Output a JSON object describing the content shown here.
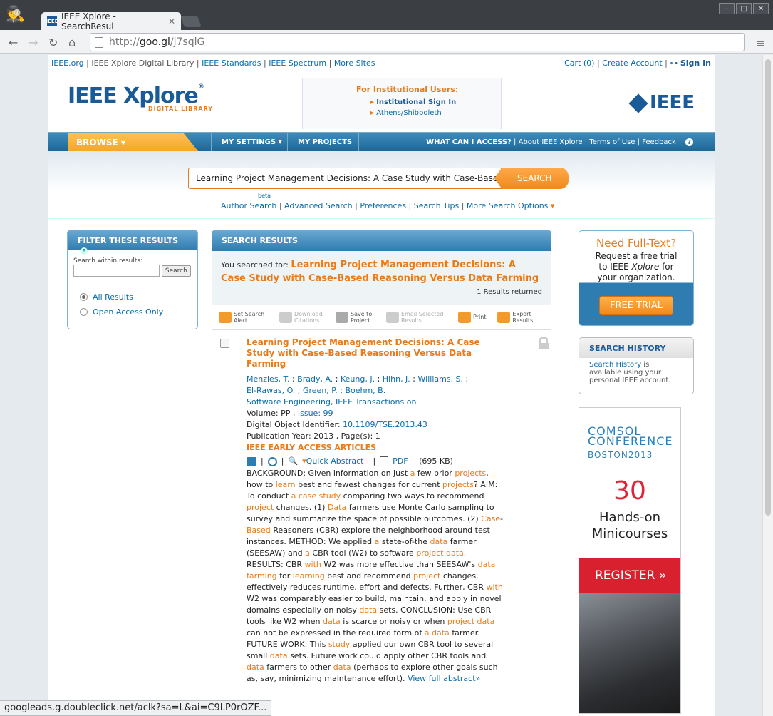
{
  "browser": {
    "tab_title": "IEEE Xplore - SearchResul",
    "url_host": "goo.gl",
    "url_prefix": "http://",
    "url_path": "/j7sqlG",
    "status_url": "googleads.g.doubleclick.net/aclk?sa=L&ai=C9LP0rOZF..."
  },
  "utility": {
    "left": [
      "IEEE.org",
      "IEEE Xplore Digital Library",
      "IEEE Standards",
      "IEEE Spectrum",
      "More Sites"
    ],
    "cart": "Cart (0)",
    "create": "Create Account",
    "signin": "Sign In"
  },
  "header": {
    "logo_main": "IEEE Xplore",
    "logo_sub": "DIGITAL LIBRARY",
    "inst_title": "For Institutional Users:",
    "inst_signin": "Institutional Sign In",
    "inst_athens": "Athens/Shibboleth",
    "ieee": "IEEE"
  },
  "nav": {
    "browse": "BROWSE",
    "settings": "MY SETTINGS",
    "projects": "MY PROJECTS",
    "access": "WHAT CAN I ACCESS?",
    "about": "About IEEE Xplore",
    "terms": "Terms of Use",
    "feedback": "Feedback",
    "help": "?"
  },
  "search": {
    "value": "Learning Project Management Decisions: A Case Study with Case-Based I",
    "button": "SEARCH",
    "author": "Author Search",
    "beta": "beta",
    "advanced": "Advanced Search",
    "prefs": "Preferences",
    "tips": "Search Tips",
    "more": "More Search Options"
  },
  "filter": {
    "title": "FILTER THESE RESULTS",
    "within": "Search within results:",
    "search_btn": "Search",
    "all": "All Results",
    "open": "Open Access Only"
  },
  "results": {
    "title": "SEARCH RESULTS",
    "searched_label": "You searched for:",
    "query": "Learning Project Management Decisions: A Case Study with Case-Based Reasoning Versus Data Farming",
    "count": "1 Results returned",
    "tools": [
      "Set Search Alert",
      "Download Citations",
      "Save to Project",
      "Email Selected Results",
      "Print",
      "Export Results"
    ]
  },
  "item": {
    "title": "Learning Project Management Decisions: A Case Study with Case-Based Reasoning Versus Data Farming",
    "authors_line1": [
      "Menzies, T.",
      "Brady, A.",
      "Keung, J.",
      "Hihn, J.",
      "Williams, S."
    ],
    "authors_line2": [
      "El-Rawas, O.",
      "Green, P.",
      "Boehm, B."
    ],
    "journal": "Software Engineering, IEEE Transactions on",
    "volume_label": "Volume: PP , ",
    "issue": "Issue: 99",
    "doi_label": "Digital Object Identifier: ",
    "doi": "10.1109/TSE.2013.43",
    "year": "Publication Year: 2013 , Page(s): 1",
    "early": "IEEE EARLY ACCESS ARTICLES",
    "quick": "Quick Abstract",
    "pdf": "PDF",
    "size": "(695 KB)",
    "view_full": "View full abstract»"
  },
  "sidebar": {
    "need": "Need Full-Text?",
    "req1": "Request a free trial",
    "req2": "to IEEE",
    "req_italic": "Xplore",
    "req3": "for",
    "req4": "your organization.",
    "trial": "FREE TRIAL",
    "history_title": "SEARCH HISTORY",
    "history_link": "Search History",
    "history_text": " is available using your personal IEEE account."
  },
  "ad": {
    "comsol": "COMSOL",
    "conference": "CONFERENCE",
    "boston": "BOSTON2013",
    "num": "30",
    "hands": "Hands-on",
    "mini": "Minicourses",
    "register": "REGISTER »"
  },
  "colors": {
    "orange": "#e87b1c",
    "blue": "#0b6ba8",
    "navy": "#1a5a96",
    "red": "#d8202f"
  }
}
